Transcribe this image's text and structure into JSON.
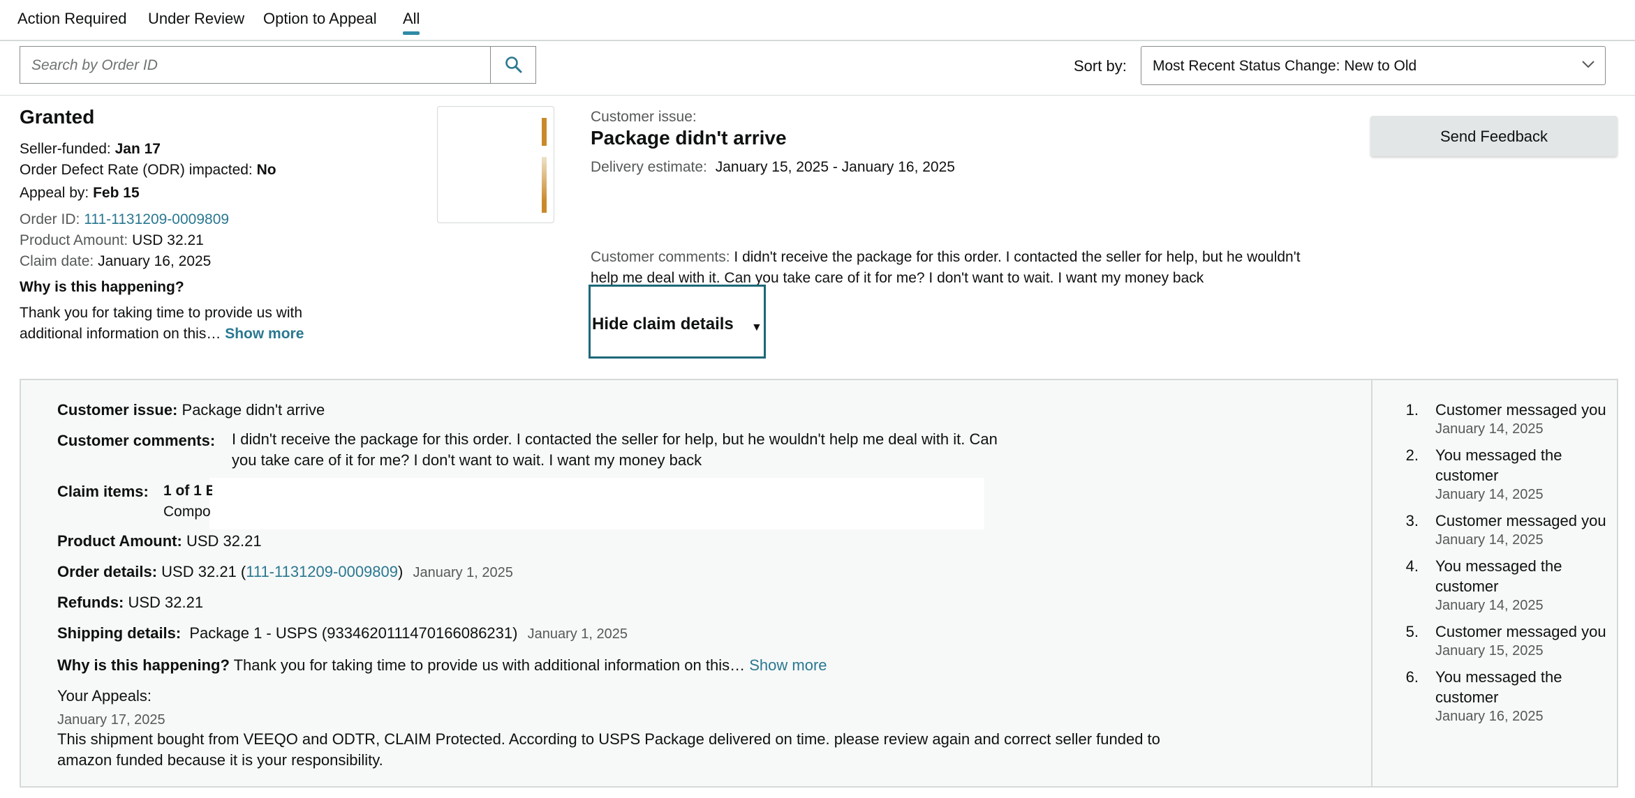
{
  "tabs": [
    "Action Required",
    "Under Review",
    "Option to Appeal",
    "All"
  ],
  "search": {
    "placeholder": "Search by Order ID"
  },
  "sort": {
    "label": "Sort by:",
    "value": "Most Recent Status Change: New to Old"
  },
  "claim": {
    "status": "Granted",
    "seller_funded_label": "Seller-funded:",
    "seller_funded_value": "Jan 17",
    "odr_label": "Order Defect Rate (ODR) impacted:",
    "odr_value": "No",
    "appeal_by_label": "Appeal by:",
    "appeal_by_value": "Feb 15",
    "order_id_label": "Order ID:",
    "order_id": "111-1131209-0009809",
    "product_amount_label": "Product Amount:",
    "product_amount": "USD 32.21",
    "claim_date_label": "Claim date:",
    "claim_date": "January 16, 2025",
    "why_label": "Why is this happening?",
    "why_text_line1": "Thank you for taking time to provide us with",
    "why_text_line2": "additional information on this…",
    "show_more": "Show more"
  },
  "issue": {
    "label": "Customer issue:",
    "title": "Package didn't arrive",
    "delivery_label": "Delivery estimate:",
    "delivery_value": "January 15, 2025 - January 16, 2025",
    "comments_label": "Customer comments:",
    "comments_text": "I didn't receive the package for this order. I contacted the seller for help, but he wouldn't help me deal with it. Can you take care of it for me? I don't want to wait. I want my money back"
  },
  "hide_details_label": "Hide claim details",
  "feedback_label": "Send Feedback",
  "details": {
    "issue_label": "Customer issue:",
    "issue_value": "Package didn't arrive",
    "comments_label": "Customer comments:",
    "comments_line1": "I didn't receive the package for this order. I contacted the seller for help, but he wouldn't help me deal with it. Can",
    "comments_line2": "you take care of it for me? I don't want to wait. I want my money back",
    "claim_items_label": "Claim items:",
    "claim_items_line1": "1 of 1 E",
    "claim_items_line2": "Compo",
    "product_amount_label": "Product Amount:",
    "product_amount": "USD 32.21",
    "order_details_label": "Order details:",
    "order_details_amount": "USD 32.21 (",
    "order_details_id": "111-1131209-0009809",
    "order_details_close": ")",
    "order_details_date": "January 1, 2025",
    "refunds_label": "Refunds:",
    "refunds_value": "USD 32.21",
    "shipping_label": "Shipping details:",
    "shipping_value": "Package 1 - USPS (9334620111470166086231)",
    "shipping_date": "January 1, 2025",
    "why_label": "Why is this happening?",
    "why_text": "Thank you for taking time to provide us with additional information on this…",
    "show_more": "Show more",
    "appeals_label": "Your Appeals:",
    "appeal_date": "January 17, 2025",
    "appeal_line1": "This shipment bought from VEEQO and ODTR, CLAIM Protected. According to USPS Package delivered on time. please review again and correct seller funded to",
    "appeal_line2": "amazon funded because it is your responsibility."
  },
  "timeline": [
    {
      "num": "1.",
      "lines": [
        "Customer messaged you"
      ],
      "date": "January 14, 2025"
    },
    {
      "num": "2.",
      "lines": [
        "You messaged the",
        "customer"
      ],
      "date": "January 14, 2025"
    },
    {
      "num": "3.",
      "lines": [
        "Customer messaged you"
      ],
      "date": "January 14, 2025"
    },
    {
      "num": "4.",
      "lines": [
        "You messaged the",
        "customer"
      ],
      "date": "January 14, 2025"
    },
    {
      "num": "5.",
      "lines": [
        "Customer messaged you"
      ],
      "date": "January 15, 2025"
    },
    {
      "num": "6.",
      "lines": [
        "You messaged the",
        "customer"
      ],
      "date": "January 16, 2025"
    }
  ]
}
